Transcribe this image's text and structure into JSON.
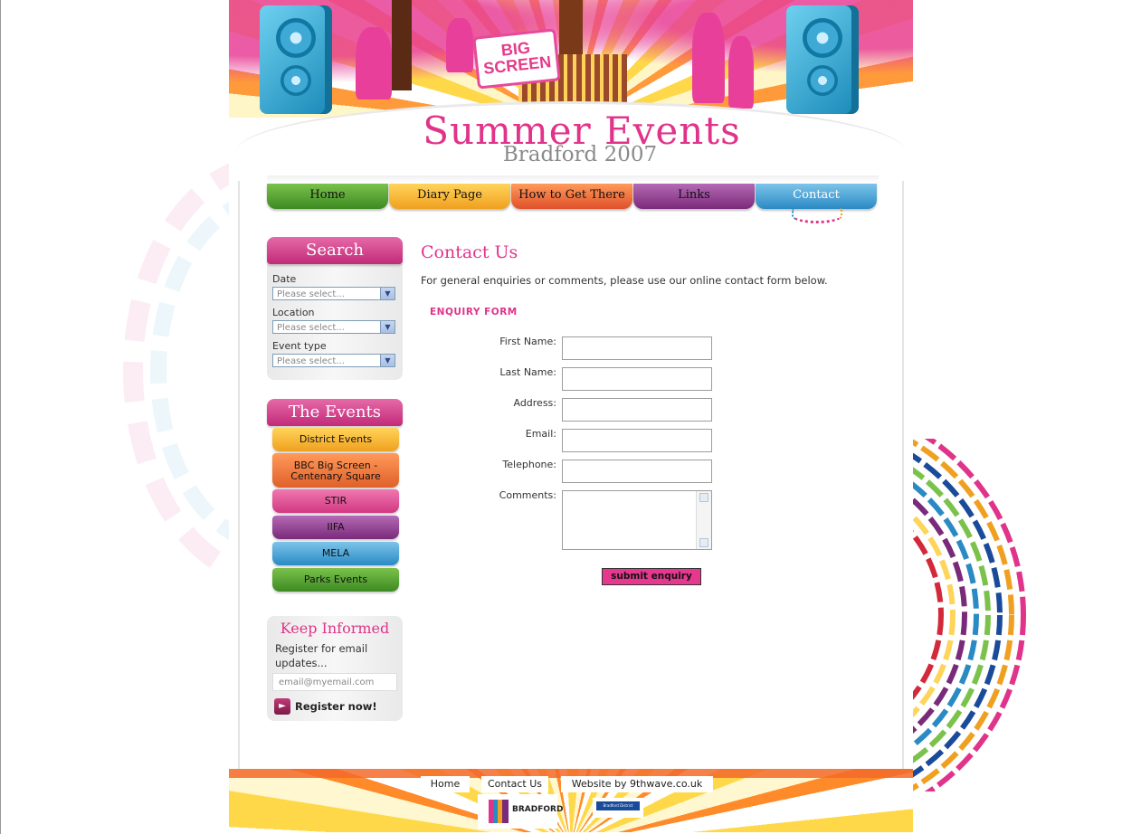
{
  "header": {
    "bigscreen_label": "BIG SCREEN",
    "title": "Summer Events",
    "subtitle": "Bradford 2007"
  },
  "nav": {
    "home": "Home",
    "diary": "Diary Page",
    "how": "How to Get There",
    "links": "Links",
    "contact": "Contact"
  },
  "search": {
    "title": "Search",
    "fields": [
      {
        "label": "Date",
        "placeholder": "Please select..."
      },
      {
        "label": "Location",
        "placeholder": "Please select..."
      },
      {
        "label": "Event type",
        "placeholder": "Please select..."
      }
    ]
  },
  "events": {
    "title": "The Events",
    "items": [
      "District Events",
      "BBC Big Screen - Centenary Square",
      "STIR",
      "IIFA",
      "MELA",
      "Parks Events"
    ]
  },
  "keep_informed": {
    "title": "Keep Informed",
    "text": "Register for email updates...",
    "placeholder": "email@myemail.com",
    "register": "Register now!"
  },
  "content": {
    "title": "Contact Us",
    "intro": "For general enquiries or comments, please use our online contact form below.",
    "form_title": "ENQUIRY FORM",
    "labels": {
      "first_name": "First Name:",
      "last_name": "Last Name:",
      "address": "Address:",
      "email": "Email:",
      "telephone": "Telephone:",
      "comments": "Comments:"
    },
    "submit": "submit enquiry"
  },
  "footer": {
    "home": "Home",
    "contact": "Contact Us",
    "website": "Website by 9thwave.co.uk",
    "bradford_logo": "BRADFORD",
    "council_logo": "Bradford District Council"
  },
  "colors": {
    "accent": "#e0338a",
    "nav_home": "#3c8a22",
    "nav_diary": "#f0a020",
    "nav_how": "#e0502a",
    "nav_links": "#7a2a7a",
    "nav_contact": "#2a8ac4"
  }
}
